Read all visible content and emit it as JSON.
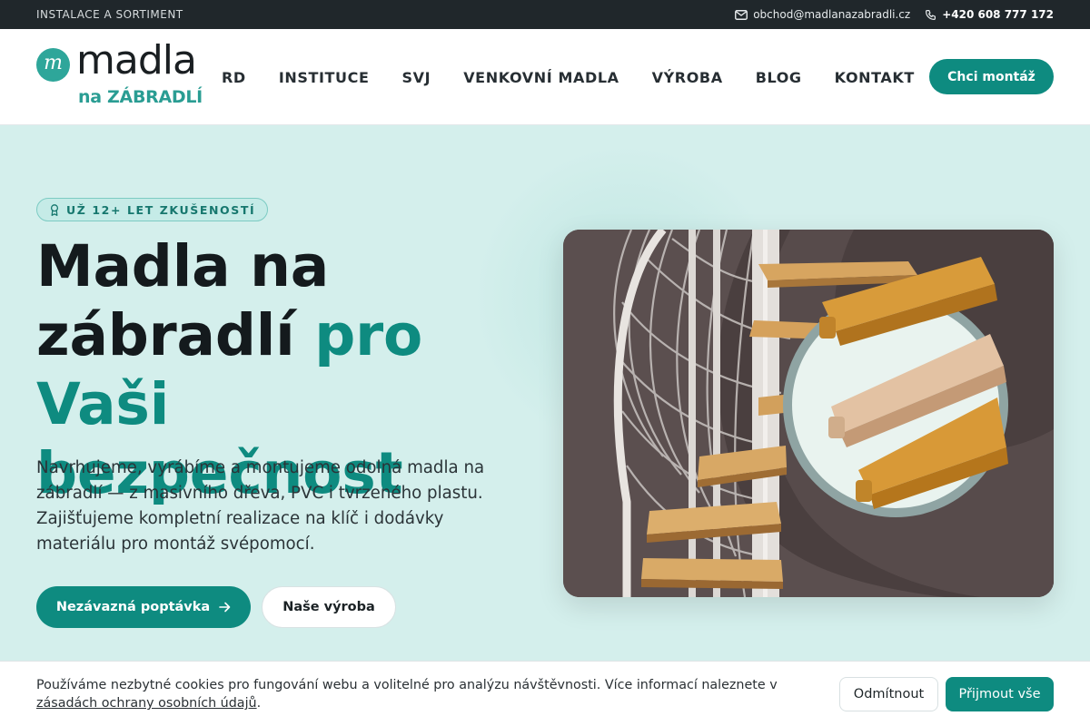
{
  "topbar": {
    "left_text": "INSTALACE A SORTIMENT",
    "email": "obchod@madlanazabradli.cz",
    "phone": "+420 608 777 172"
  },
  "logo": {
    "mark": "m",
    "word": "madla",
    "sub": "na ZÁBRADLÍ"
  },
  "nav": {
    "items": [
      "RD",
      "INSTITUCE",
      "SVJ",
      "VENKOVNÍ MADLA",
      "VÝROBA",
      "BLOG",
      "KONTAKT"
    ],
    "cta": "Chci montáž"
  },
  "hero": {
    "badge": "UŽ 12+ LET ZKUŠENOSTÍ",
    "title_line1": "Madla na",
    "title_line2a": "zábradlí ",
    "title_line2b": "pro",
    "title_line3": "Vaši bezpečnost",
    "lead": "Navrhujeme, vyrábíme a montujeme odolná madla na zábradlí — z masivního dřeva, PVC i tvrzeného plastu. Zajišťujeme kompletní realizace na klíč i dodávky materiálu pro montáž svépomocí.",
    "primary_button": "Nezávazná poptávka",
    "secondary_button": "Naše výroba"
  },
  "cookie": {
    "text": "Používáme nezbytné cookies pro fungování webu a volitelné pro analýzu návštěvnosti. Více informací naleznete v ",
    "link": "zásadách ochrany osobních údajů",
    "end": ".",
    "reject": "Odmítnout",
    "accept": "Přijmout vše"
  },
  "colors": {
    "accent": "#0e8b80",
    "topbar": "#20272b",
    "hero_bg": "#d4efec"
  },
  "icons": {
    "mail": "mail-icon",
    "phone": "phone-icon",
    "badge": "award-icon",
    "arrow": "arrow-right-icon"
  }
}
